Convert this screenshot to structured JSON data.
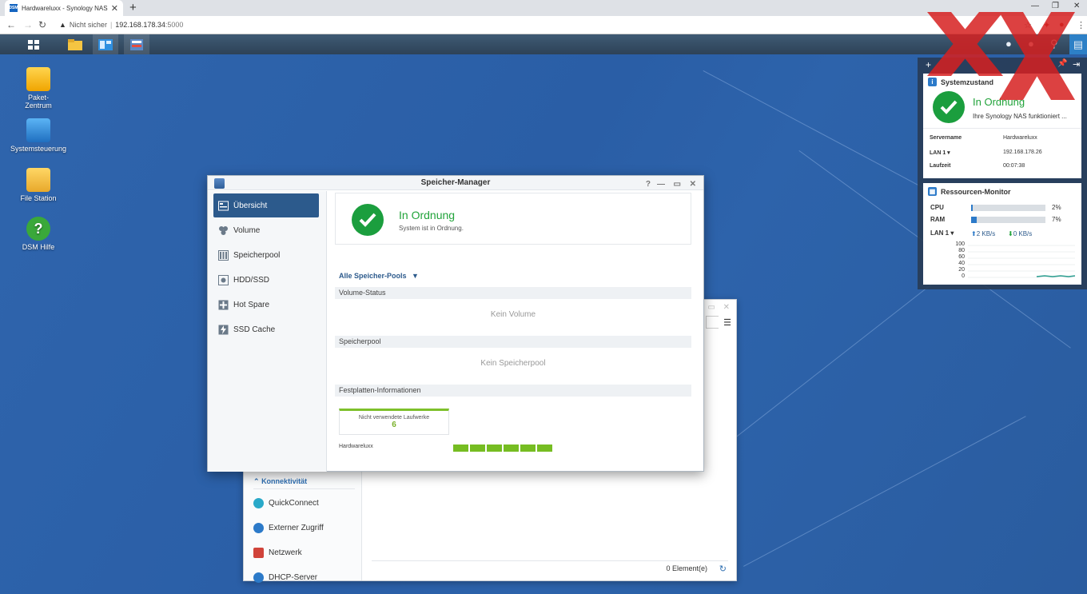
{
  "browser": {
    "tab_title": "Hardwareluxx - Synology NAS",
    "favicon_text": "DSM",
    "tab_close": "✕",
    "new_tab": "+",
    "security_label": "Nicht sicher",
    "url_host": "192.168.178.34",
    "url_port": ":5000"
  },
  "desktop_icons": [
    {
      "label": "Paket-Zentrum"
    },
    {
      "label": "Systemsteuerung"
    },
    {
      "label": "File Station"
    },
    {
      "label": "DSM Hilfe"
    }
  ],
  "storage_manager": {
    "title": "Speicher-Manager",
    "sidebar": [
      {
        "label": "Übersicht",
        "active": true
      },
      {
        "label": "Volume"
      },
      {
        "label": "Speicherpool"
      },
      {
        "label": "HDD/SSD"
      },
      {
        "label": "Hot Spare"
      },
      {
        "label": "SSD Cache"
      }
    ],
    "status_title": "In Ordnung",
    "status_sub": "System ist in Ordnung.",
    "pool_selector": "Alle Speicher-Pools",
    "volume_status_header": "Volume-Status",
    "volume_empty": "Kein Volume",
    "pool_header": "Speicherpool",
    "pool_empty": "Kein Speicherpool",
    "disk_info_header": "Festplatten-Informationen",
    "unused_drives_label": "Nicht verwendete Laufwerke",
    "unused_drives_count": "6",
    "server_name": "Hardwareluxx",
    "slot_count": 6
  },
  "background_window": {
    "section": "Konnektivität",
    "items": [
      {
        "label": "QuickConnect",
        "color": "#29a9c9"
      },
      {
        "label": "Externer Zugriff",
        "color": "#2c7ac9"
      },
      {
        "label": "Netzwerk",
        "color": "#d0433a"
      },
      {
        "label": "DHCP-Server",
        "color": "#2c7ac9"
      }
    ],
    "count": "0 Element(e)"
  },
  "system_health": {
    "title": "Systemzustand",
    "status": "In Ordnung",
    "sub": "Ihre Synology NAS funktioniert ...",
    "rows": [
      {
        "key": "Servername",
        "value": "Hardwareluxx"
      },
      {
        "key": "LAN 1 ▾",
        "value": "192.168.178.26"
      },
      {
        "key": "Laufzeit",
        "value": "00:07:38"
      }
    ]
  },
  "resource_monitor": {
    "title": "Ressourcen-Monitor",
    "cpu_label": "CPU",
    "cpu_value": "2%",
    "cpu_fraction": 0.02,
    "ram_label": "RAM",
    "ram_value": "7%",
    "ram_fraction": 0.07,
    "lan_label": "LAN 1 ▾",
    "upload": "2 KB/s",
    "download": "0 KB/s",
    "yticks": [
      "100",
      "80",
      "60",
      "40",
      "20",
      "0"
    ]
  },
  "colors": {
    "accent": "#2c5a8c",
    "ok_green": "#21a33a",
    "disk_green": "#76bd22",
    "watermark": "#d62020"
  }
}
